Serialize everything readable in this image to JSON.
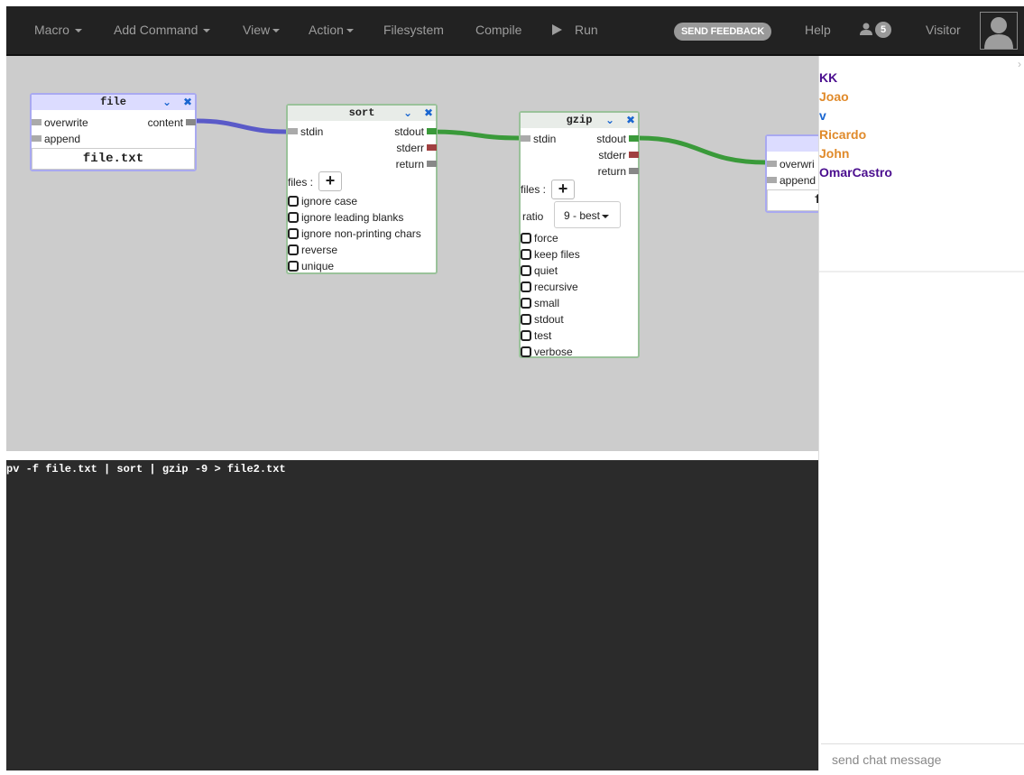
{
  "navbar": {
    "macro": "Macro",
    "add_command": "Add Command",
    "view": "View",
    "action": "Action",
    "filesystem": "Filesystem",
    "compile": "Compile",
    "run": "Run",
    "send_feedback": "SEND FEEDBACK",
    "help": "Help",
    "user_count": "5",
    "visitor": "Visitor"
  },
  "nodes": {
    "file": {
      "title": "file",
      "inputs": [
        "overwrite",
        "append"
      ],
      "output": "content",
      "filename": "file.txt"
    },
    "sort": {
      "title": "sort",
      "input": "stdin",
      "outputs": [
        "stdout",
        "stderr",
        "return"
      ],
      "files_label": "files :",
      "options": [
        "ignore case",
        "ignore leading blanks",
        "ignore non-printing chars",
        "reverse",
        "unique"
      ]
    },
    "gzip": {
      "title": "gzip",
      "input": "stdin",
      "outputs": [
        "stdout",
        "stderr",
        "return"
      ],
      "files_label": "files :",
      "ratio_label": "ratio",
      "ratio_value": "9 - best",
      "options": [
        "force",
        "keep files",
        "quiet",
        "recursive",
        "small",
        "stdout",
        "test",
        "verbose"
      ]
    },
    "file2": {
      "inputs": [
        "overwri",
        "append"
      ],
      "filename": "f"
    }
  },
  "terminal": {
    "command": "pv -f file.txt | sort | gzip -9 > file2.txt"
  },
  "users": [
    {
      "name": "KK",
      "color": "#4b0f8f"
    },
    {
      "name": "Joao",
      "color": "#e08a2a"
    },
    {
      "name": "v",
      "color": "#1a66d0"
    },
    {
      "name": "Ricardo",
      "color": "#e08a2a"
    },
    {
      "name": "John",
      "color": "#e08a2a"
    },
    {
      "name": "OmarCastro",
      "color": "#4b0f8f"
    }
  ],
  "chat": {
    "placeholder": "send chat message"
  }
}
